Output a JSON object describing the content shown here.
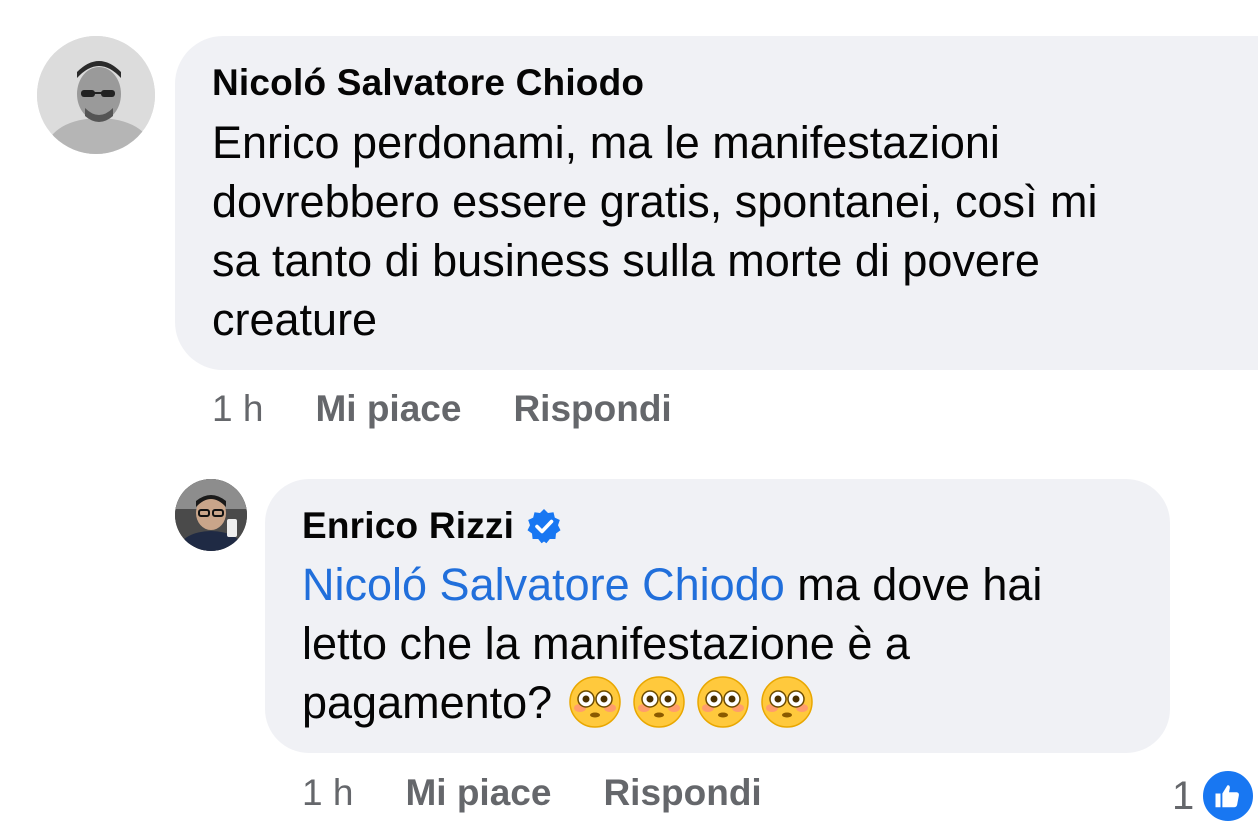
{
  "comments": [
    {
      "author": "Nicoló Salvatore Chiodo",
      "lines": [
        "Enrico perdonami, ma le manifestazioni",
        "dovrebbero essere gratis, spontanei, così mi",
        "sa tanto di business sulla morte di povere",
        "creature"
      ],
      "time": "1 h",
      "like_label": "Mi piace",
      "reply_label": "Rispondi"
    },
    {
      "author": "Enrico Rizzi",
      "verified": true,
      "mention": "Nicoló Salvatore Chiodo",
      "line1_rest": " ma dove hai",
      "line2": "letto che la manifestazione è a",
      "line3": "pagamento?",
      "emoji_count": 4,
      "time": "1 h",
      "like_label": "Mi piace",
      "reply_label": "Rispondi",
      "reaction_count": "1"
    }
  ],
  "colors": {
    "bubble": "#f0f1f5",
    "mention": "#216fdb",
    "meta": "#65676b",
    "like_icon": "#1877f2",
    "verified_badge": "#1877f2"
  },
  "icons": [
    "verified-badge-icon",
    "flushed-face-emoji",
    "thumbs-up-icon"
  ]
}
